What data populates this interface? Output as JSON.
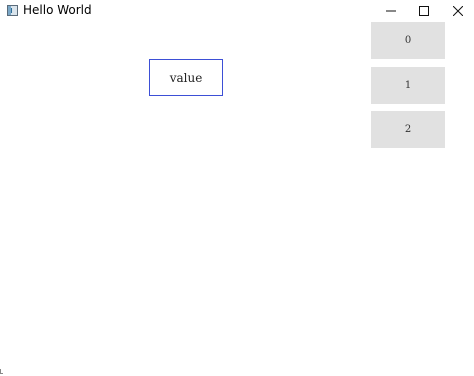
{
  "window": {
    "title": "Hello World",
    "controls": {
      "minimize_icon": "minimize-icon",
      "maximize_icon": "maximize-icon",
      "close_icon": "close-icon"
    }
  },
  "main": {
    "value_label": "value"
  },
  "sidebar": {
    "buttons": [
      {
        "label": "0"
      },
      {
        "label": "1"
      },
      {
        "label": "2"
      }
    ]
  },
  "colors": {
    "value_border": "#3d4fd6",
    "button_bg": "#e1e1e1"
  }
}
